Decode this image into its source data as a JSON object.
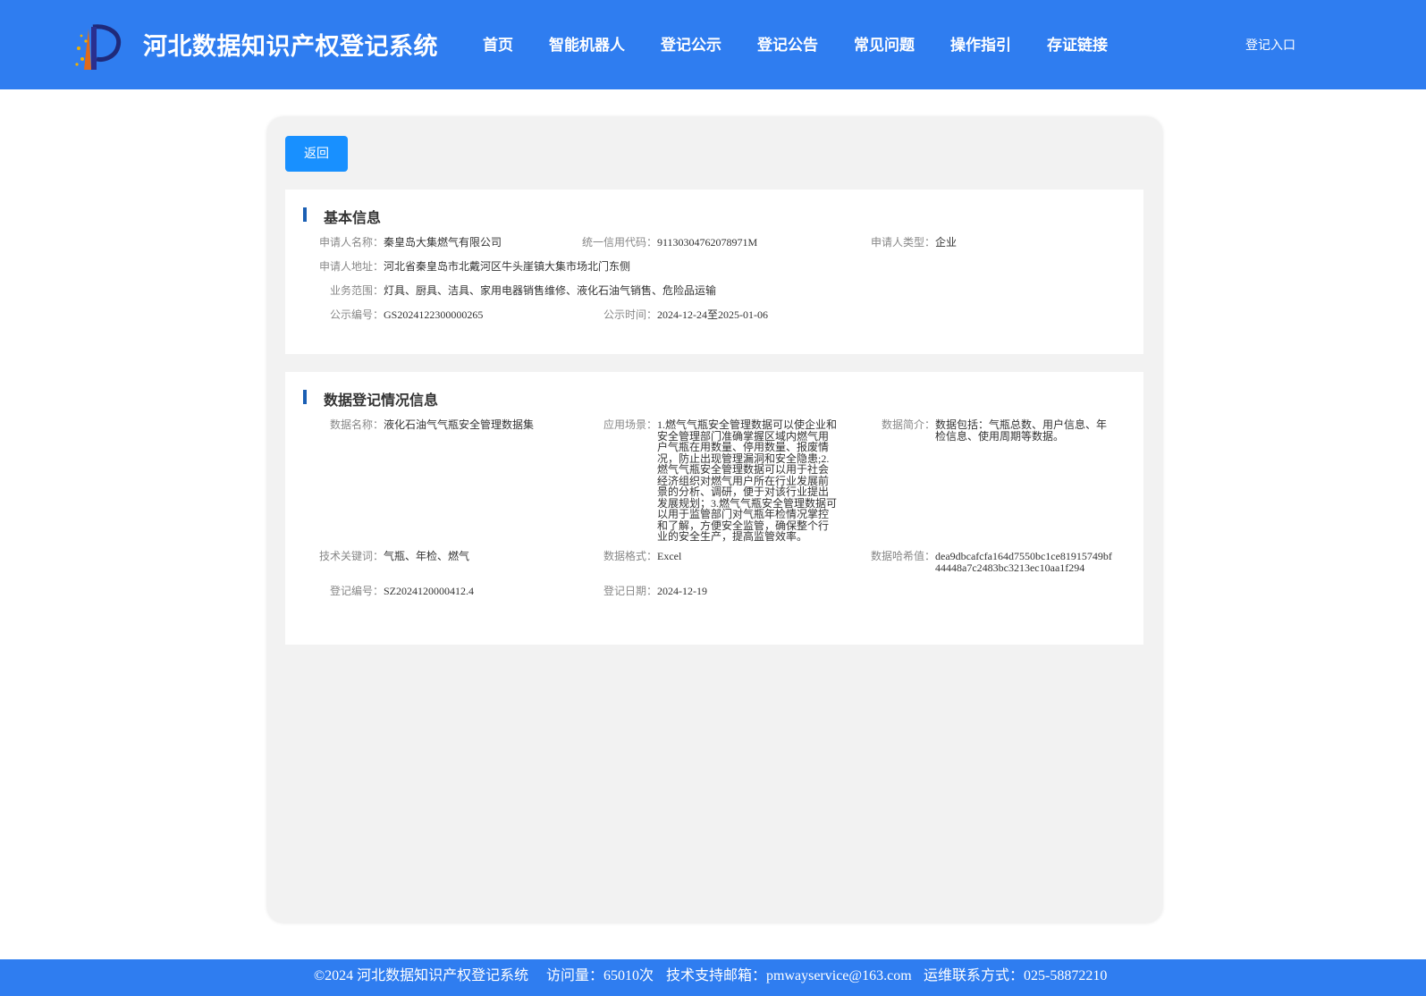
{
  "header": {
    "site_title": "河北数据知识产权登记系统",
    "nav": [
      "首页",
      "智能机器人",
      "登记公示",
      "登记公告",
      "常见问题",
      "操作指引",
      "存证链接"
    ],
    "login_label": "登记入口"
  },
  "back_label": "返回",
  "basic": {
    "title": "基本信息",
    "applicant_name_label": "申请人名称：",
    "applicant_name": "秦皇岛大集燃气有限公司",
    "credit_code_label": "统一信用代码：",
    "credit_code": "91130304762078971M",
    "applicant_type_label": "申请人类型：",
    "applicant_type": "企业",
    "address_label": "申请人地址：",
    "address": "河北省秦皇岛市北戴河区牛头崖镇大集市场北门东侧",
    "scope_label": "业务范围：",
    "scope": "灯具、厨具、洁具、家用电器销售维修、液化石油气销售、危险品运输",
    "pub_no_label": "公示编号：",
    "pub_no": "GS2024122300000265",
    "pub_time_label": "公示时间：",
    "pub_time": "2024-12-24至2025-01-06"
  },
  "registration": {
    "title": "数据登记情况信息",
    "data_name_label": "数据名称：",
    "data_name": "液化石油气气瓶安全管理数据集",
    "scenario_label": "应用场景：",
    "scenario": "1.燃气气瓶安全管理数据可以使企业和安全管理部门准确掌握区域内燃气用户气瓶在用数量、停用数量、报废情况，防止出现管理漏洞和安全隐患;2.燃气气瓶安全管理数据可以用于社会经济组织对燃气用户所在行业发展前景的分析、调研，便于对该行业提出发展规划；3.燃气气瓶安全管理数据可以用于监管部门对气瓶年检情况掌控和了解，方便安全监管，确保整个行业的安全生产，提高监管效率。",
    "intro_label": "数据简介：",
    "intro": "数据包括：气瓶总数、用户信息、年检信息、使用周期等数据。",
    "keywords_label": "技术关键词：",
    "keywords": "气瓶、年检、燃气",
    "format_label": "数据格式：",
    "format": "Excel",
    "hash_label": "数据哈希值：",
    "hash": "dea9dbcafcfa164d7550bc1ce81915749bf44448a7c2483bc3213ec10aa1f294",
    "reg_no_label": "登记编号：",
    "reg_no": "SZ2024120000412.4",
    "reg_date_label": "登记日期：",
    "reg_date": "2024-12-19"
  },
  "footer": {
    "copyright": "©2024 河北数据知识产权登记系统",
    "visits": "访问量：65010次",
    "support": "技术支持邮箱：pmwayservice@163.com",
    "ops": "运维联系方式：025-58872210"
  },
  "colors": {
    "header_bg": "#2f7df0",
    "button_bg": "#1890ff",
    "section_bar": "#1a5fb4"
  }
}
